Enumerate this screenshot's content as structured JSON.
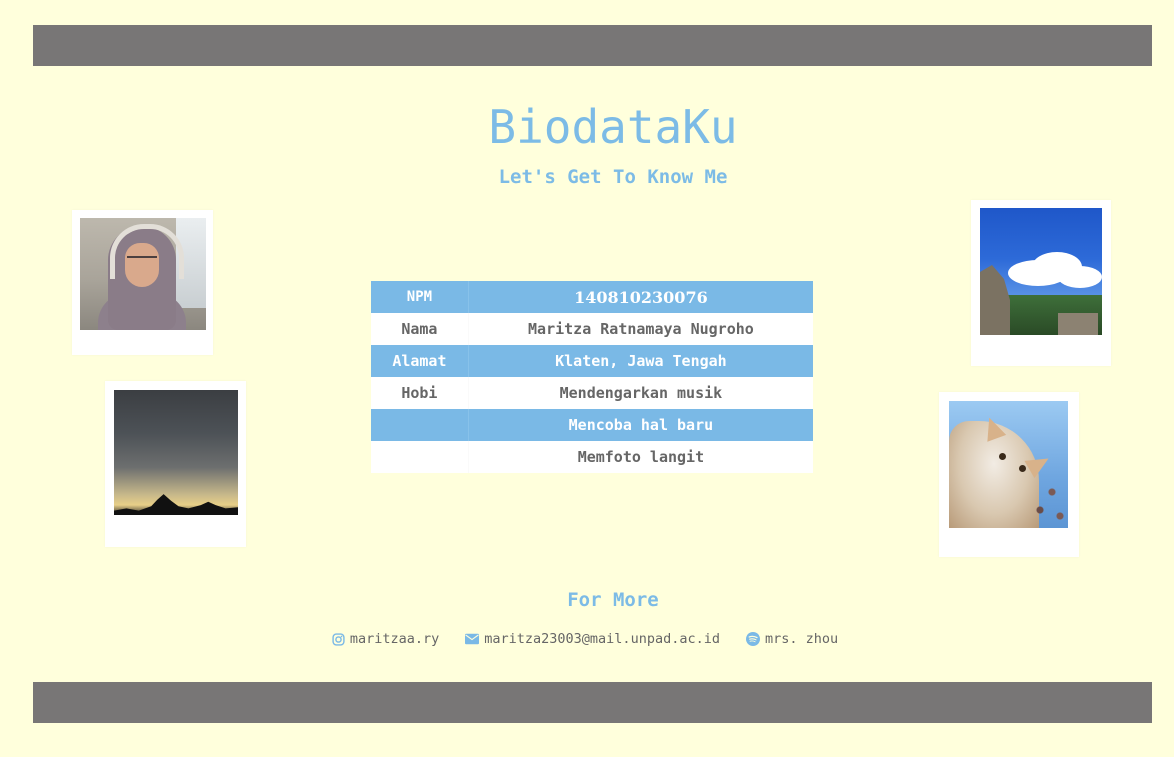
{
  "header": {
    "title": "BiodataKu",
    "subtitle": "Let's Get To Know Me"
  },
  "biodata": {
    "rows": [
      {
        "label": "NPM",
        "value": "140810230076"
      },
      {
        "label": "Nama",
        "value": "Maritza Ratnamaya Nugroho"
      },
      {
        "label": "Alamat",
        "value": "Klaten, Jawa Tengah"
      },
      {
        "label": "Hobi",
        "value": "Mendengarkan musik"
      },
      {
        "label": "",
        "value": "Mencoba hal baru"
      },
      {
        "label": "",
        "value": "Memfoto langit"
      }
    ]
  },
  "footer": {
    "heading": "For More",
    "contacts": [
      {
        "icon": "instagram-icon",
        "text": "maritzaa.ry"
      },
      {
        "icon": "envelope-icon",
        "text": "maritza23003@mail.unpad.ac.id"
      },
      {
        "icon": "spotify-icon",
        "text": "mrs. zhou"
      }
    ]
  },
  "colors": {
    "background": "#ffffdc",
    "bar": "#787676",
    "accent": "#7ab9e6",
    "text_gray": "#666666"
  }
}
